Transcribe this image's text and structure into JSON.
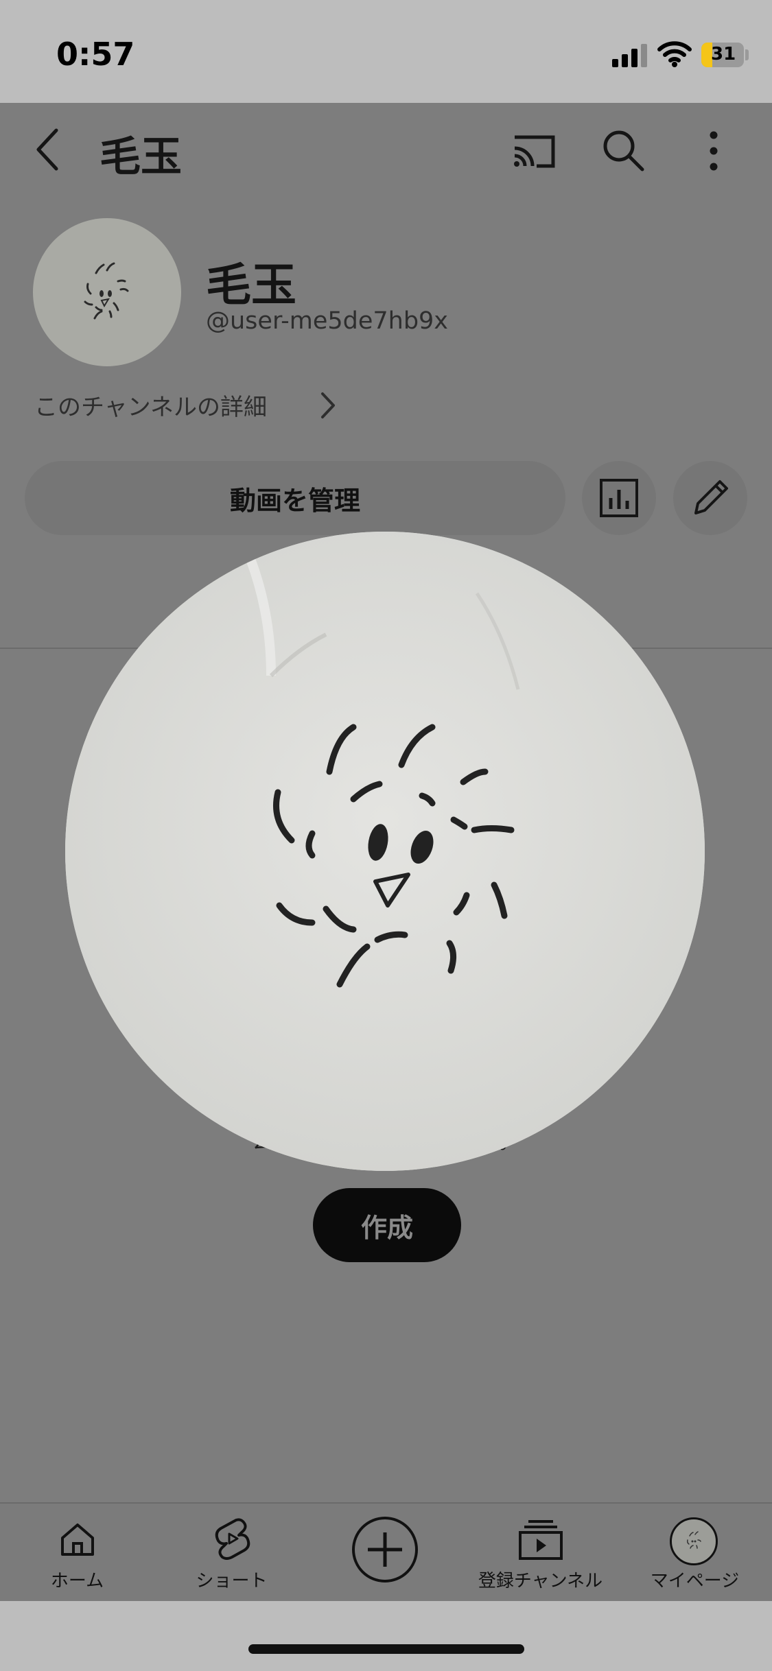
{
  "status_bar": {
    "time": "0:57",
    "battery": "31"
  },
  "header": {
    "title": "毛玉",
    "icons": [
      "back-icon",
      "cast-icon",
      "search-icon",
      "more-vert-icon"
    ]
  },
  "channel": {
    "name": "毛玉",
    "handle": "@user-me5de7hb9x",
    "details_link": "このチャンネルの詳細",
    "manage_button": "動画を管理",
    "action_icons": [
      "analytics-icon",
      "edit-pencil-icon"
    ]
  },
  "empty_state": {
    "title": "どの ま す",
    "line1": "自宅でも 能です。",
    "line2": "公開したす 表示されます。",
    "create_button": "作成"
  },
  "tabbar": {
    "tabs": [
      {
        "label": "ホーム",
        "icon": "home-icon"
      },
      {
        "label": "ショート",
        "icon": "shorts-icon"
      },
      {
        "label": "",
        "icon": "add-icon"
      },
      {
        "label": "登録チャンネル",
        "icon": "subscriptions-icon"
      },
      {
        "label": "マイページ",
        "icon": "avatar"
      }
    ]
  },
  "colors": {
    "scrim": "#7d7d7d",
    "status_bar_bg": "#bdbdbd",
    "create_button_bg": "#0b0b0b",
    "battery_accent": "#f5c518",
    "avatar_paper": "#dcdcd9"
  }
}
